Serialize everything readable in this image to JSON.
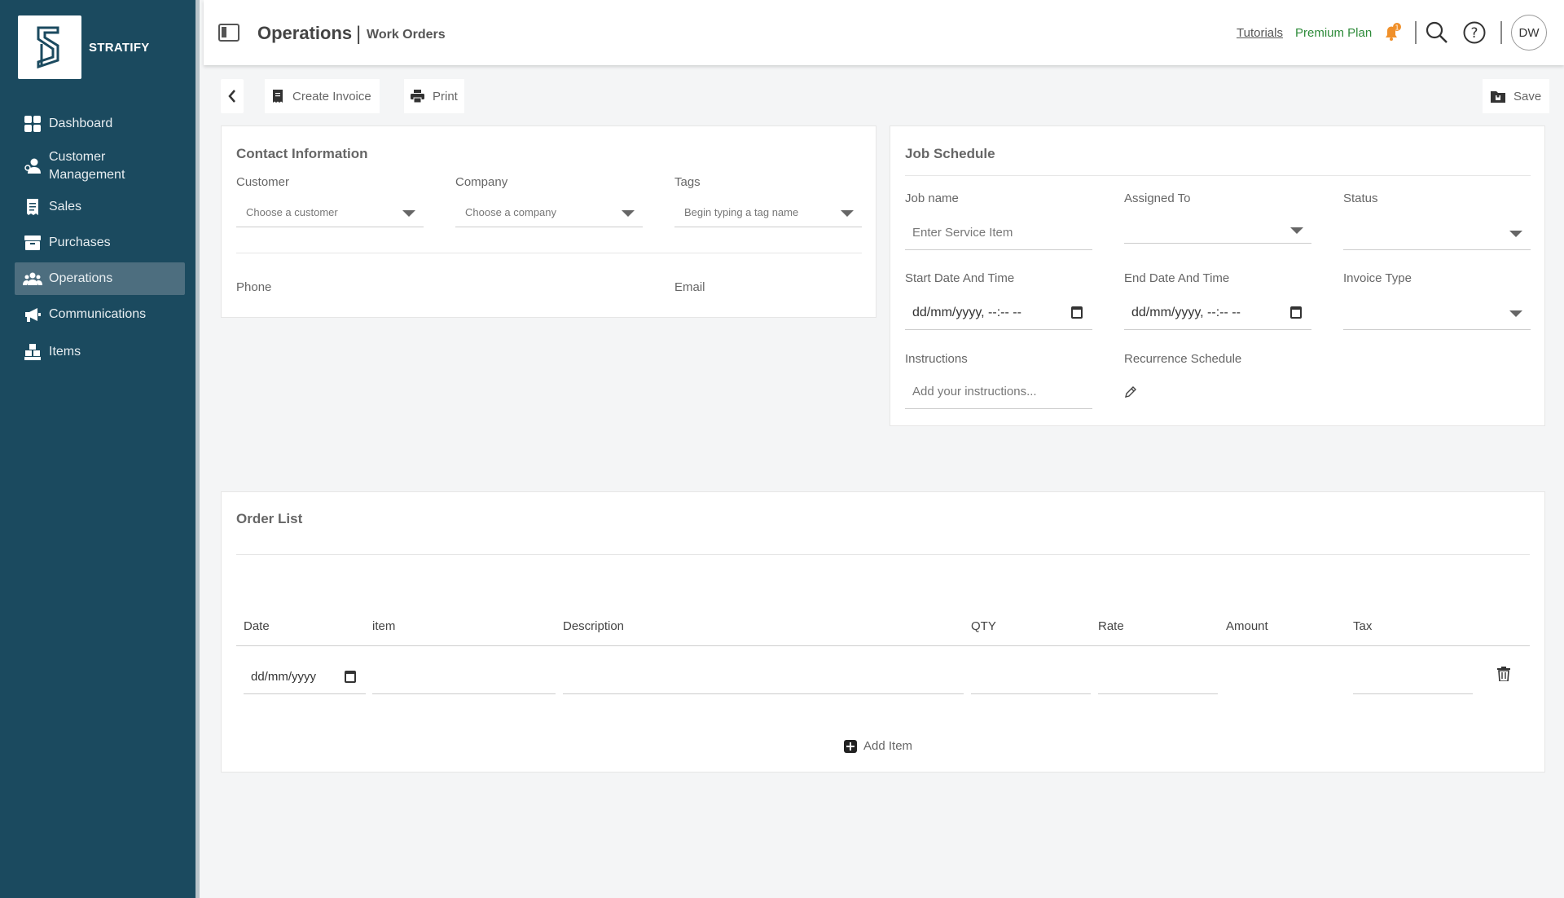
{
  "brand": {
    "name": "STRATIFY"
  },
  "sidebar": {
    "items": [
      {
        "label": "Dashboard",
        "icon": "dashboard-icon"
      },
      {
        "label": "Customer Management",
        "icon": "customer-icon"
      },
      {
        "label": "Sales",
        "icon": "receipt-icon"
      },
      {
        "label": "Purchases",
        "icon": "box-icon"
      },
      {
        "label": "Operations",
        "icon": "team-icon",
        "active": true
      },
      {
        "label": "Communications",
        "icon": "megaphone-icon"
      },
      {
        "label": "Items",
        "icon": "items-icon"
      }
    ]
  },
  "header": {
    "title": "Operations",
    "separator": "|",
    "subtitle": "Work Orders",
    "tutorials": "Tutorials",
    "plan": "Premium Plan",
    "notification_count": "1",
    "avatar_initials": "DW"
  },
  "toolbar": {
    "create_invoice": "Create Invoice",
    "print": "Print",
    "save": "Save"
  },
  "contact": {
    "title": "Contact Information",
    "customer_label": "Customer",
    "customer_placeholder": "Choose a customer",
    "company_label": "Company",
    "company_placeholder": "Choose a company",
    "tags_label": "Tags",
    "tags_placeholder": "Begin typing a tag name",
    "phone_label": "Phone",
    "email_label": "Email"
  },
  "job": {
    "title": "Job Schedule",
    "job_name_label": "Job name",
    "job_name_placeholder": "Enter Service Item",
    "assigned_label": "Assigned To",
    "status_label": "Status",
    "start_label": "Start Date And Time",
    "start_value": "dd/mm/yyyy, --:-- --",
    "end_label": "End Date And Time",
    "end_value": "dd/mm/yyyy, --:-- --",
    "invoice_type_label": "Invoice Type",
    "instructions_label": "Instructions",
    "instructions_placeholder": "Add your instructions...",
    "recurrence_label": "Recurrence Schedule"
  },
  "order": {
    "title": "Order List",
    "columns": [
      "Date",
      "item",
      "Description",
      "QTY",
      "Rate",
      "Amount",
      "Tax"
    ],
    "row_date": "dd/mm/yyyy",
    "add_item": "Add Item"
  },
  "colors": {
    "sidebar_bg": "#1b4a5f",
    "active_item": "#4d6e7f",
    "premium": "#2e8b3a",
    "badge": "#f0902a"
  }
}
